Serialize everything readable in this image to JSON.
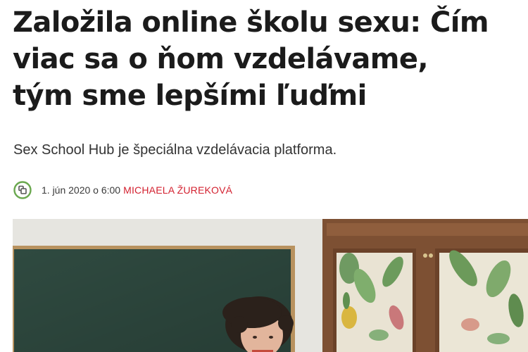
{
  "article": {
    "headline_lines": [
      "Založila online školu sexu: Čím",
      "viac sa o ňom vzdelávame,",
      "tým sme lepšími ľuďmi"
    ],
    "perex": "Sex School Hub je špeciálna vzdelávacia platforma.",
    "meta": {
      "icon": "share-link-icon",
      "date": "1. jún 2020 o 6:00",
      "author": "MICHAELA ŽUREKOVÁ"
    },
    "photo": {
      "subject": "woman-in-front-of-chalkboard"
    }
  },
  "colors": {
    "accent": "#d3202f",
    "icon_green": "#6aa84f",
    "chalkboard": "#2f4a40",
    "wood": "#8a5a3c"
  }
}
